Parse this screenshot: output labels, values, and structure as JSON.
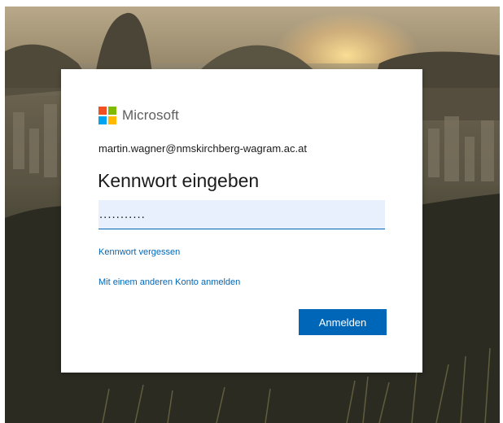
{
  "brand": {
    "name": "Microsoft",
    "logo_colors": [
      "#f25022",
      "#7fba00",
      "#00a4ef",
      "#ffb900"
    ]
  },
  "signin": {
    "identity": "martin.wagner@nmskirchberg-wagram.ac.at",
    "title": "Kennwort eingeben",
    "password_value": "...........",
    "forgot_password_label": "Kennwort vergessen",
    "other_account_label": "Mit einem anderen Konto anmelden",
    "submit_label": "Anmelden"
  },
  "colors": {
    "accent": "#0067b8",
    "input_background": "#e8f0fe",
    "text": "#1b1b1b"
  }
}
